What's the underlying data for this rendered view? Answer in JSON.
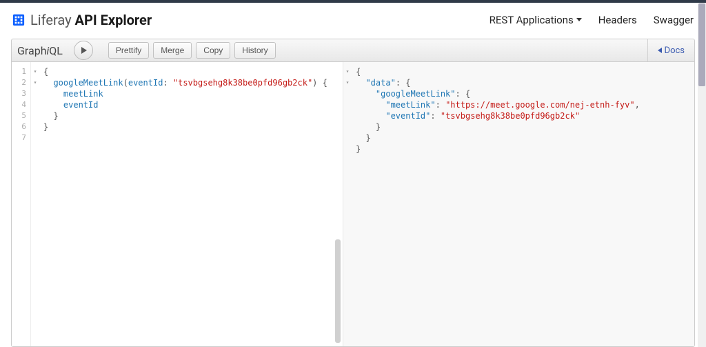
{
  "header": {
    "brand_prefix": "Liferay",
    "brand_suffix": "API Explorer",
    "nav": {
      "rest_applications": "REST Applications",
      "headers": "Headers",
      "swagger": "Swagger"
    }
  },
  "toolbar": {
    "title_graph": "Graph",
    "title_i": "i",
    "title_ql": "QL",
    "prettify": "Prettify",
    "merge": "Merge",
    "copy": "Copy",
    "history": "History",
    "docs": "Docs"
  },
  "query": {
    "lines": [
      "1",
      "2",
      "3",
      "4",
      "5",
      "6",
      "7"
    ],
    "fold_marks": [
      "▾",
      "▾",
      "",
      "",
      "",
      "",
      ""
    ],
    "l1_open": "{",
    "l2_fn": "googleMeetLink",
    "l2_open_paren": "(",
    "l2_arg": "eventId",
    "l2_colon": ": ",
    "l2_str": "\"tsvbgsehg8k38be0pfd96gb2ck\"",
    "l2_close_paren_brace": ") {",
    "l3_field1": "meetLink",
    "l4_field2": "eventId",
    "l5_close": "}",
    "l6_close": "}"
  },
  "response": {
    "fold_marks": [
      "▾",
      "▾",
      "",
      "",
      "",
      "",
      "",
      ""
    ],
    "l1": "{",
    "l2_key": "\"data\"",
    "l2_rest": ": {",
    "l3_key": "\"googleMeetLink\"",
    "l3_rest": ": {",
    "l4_key": "\"meetLink\"",
    "l4_sep": ": ",
    "l4_val": "\"https://meet.google.com/nej-etnh-fyv\"",
    "l4_comma": ",",
    "l5_key": "\"eventId\"",
    "l5_sep": ": ",
    "l5_val": "\"tsvbgsehg8k38be0pfd96gb2ck\"",
    "l6_close": "}",
    "l7_close": "}",
    "l8_close": "}"
  }
}
